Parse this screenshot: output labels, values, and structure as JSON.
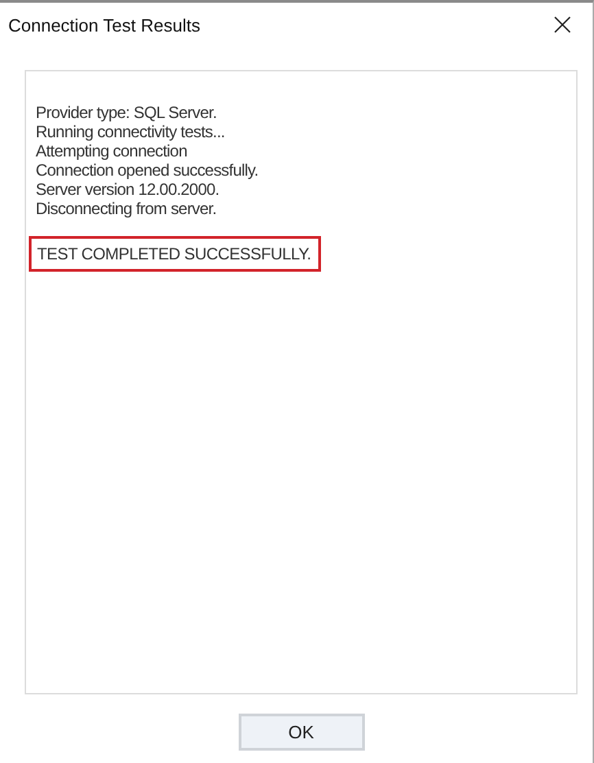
{
  "window": {
    "title": "Connection Test Results"
  },
  "log": {
    "lines": [
      "Provider type: SQL Server.",
      "Running connectivity tests...",
      "Attempting connection",
      "Connection opened successfully.",
      "Server version 12.00.2000.",
      "Disconnecting from server."
    ],
    "result": {
      "text": "TEST COMPLETED SUCCESSFULLY.",
      "highlighted": true
    }
  },
  "buttons": [
    {
      "label": "OK"
    }
  ]
}
